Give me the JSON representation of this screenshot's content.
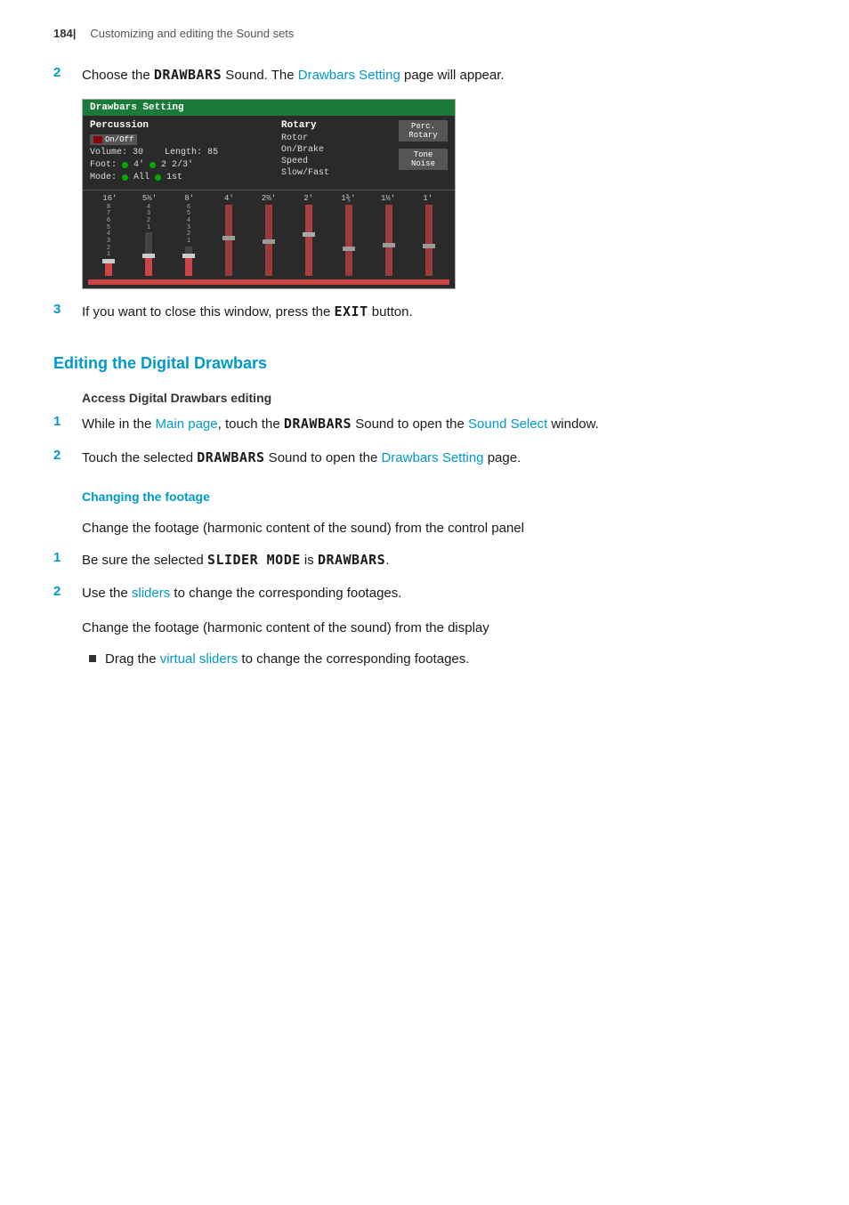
{
  "header": {
    "page_num": "184|",
    "title": "Customizing and editing the Sound sets"
  },
  "step2_intro": "Choose the ",
  "step2_drawbars": "DRAWBARS",
  "step2_mid": " Sound. The ",
  "step2_setting": "Drawbars Setting",
  "step2_end": " page will appear.",
  "screenshot": {
    "title": "Drawbars Setting",
    "percussion_label": "Percussion",
    "on_off": "On/Off",
    "volume_label": "Volume:",
    "volume_val": "30",
    "length_label": "Length:",
    "length_val": "85",
    "foot_label": "Foot:",
    "foot_val1": "4'",
    "foot_val2": "2 2/3'",
    "mode_label": "Mode:",
    "mode_val1": "All",
    "mode_val2": "1st",
    "rotary_label": "Rotary",
    "rotor_label": "Rotor",
    "on_brake": "On/Brake",
    "speed_label": "Speed",
    "slow_fast": "Slow/Fast",
    "perc_rotary": "Perc. Rotary",
    "tone_noise": "Tone Noise",
    "ruler": [
      "16'",
      "5 1/3'",
      "8'",
      "4'",
      "2 2/3'",
      "2'",
      "1 3/5'",
      "1 1/3'",
      "1'"
    ]
  },
  "step3_text": "If you want to close this window, press the ",
  "step3_exit": "EXIT",
  "step3_end": " button.",
  "editing_heading": "Editing the Digital Drawbars",
  "access_subheading": "Access Digital Drawbars editing",
  "step1a_pre": "While in the ",
  "step1a_main": "Main page",
  "step1a_mid": ", touch the ",
  "step1a_drawbars": "DRAWBARS",
  "step1a_post": " Sound to open the ",
  "step1a_sound": "Sound Select",
  "step1a_end": " window.",
  "step2a_pre": "Touch the selected ",
  "step2a_drawbars": "DRAWBARS",
  "step2a_mid": " Sound to open the ",
  "step2a_setting": "Drawbars Setting",
  "step2a_end": " page.",
  "changing_footage_heading": "Changing the footage",
  "change_control_text": "Change the footage (harmonic content of the sound) from the control panel",
  "step1b_pre": "Be sure the selected ",
  "step1b_slider": "SLIDER MODE",
  "step1b_mid": " is ",
  "step1b_drawbars": "DRAWBARS",
  "step1b_end": ".",
  "step2b_pre": "Use the ",
  "step2b_sliders": "sliders",
  "step2b_end": " to change the corresponding footages.",
  "change_display_text": "Change the footage (harmonic content of the sound) from the display",
  "bullet_pre": "Drag the ",
  "bullet_sliders": "virtual sliders",
  "bullet_end": " to change the corresponding footages."
}
